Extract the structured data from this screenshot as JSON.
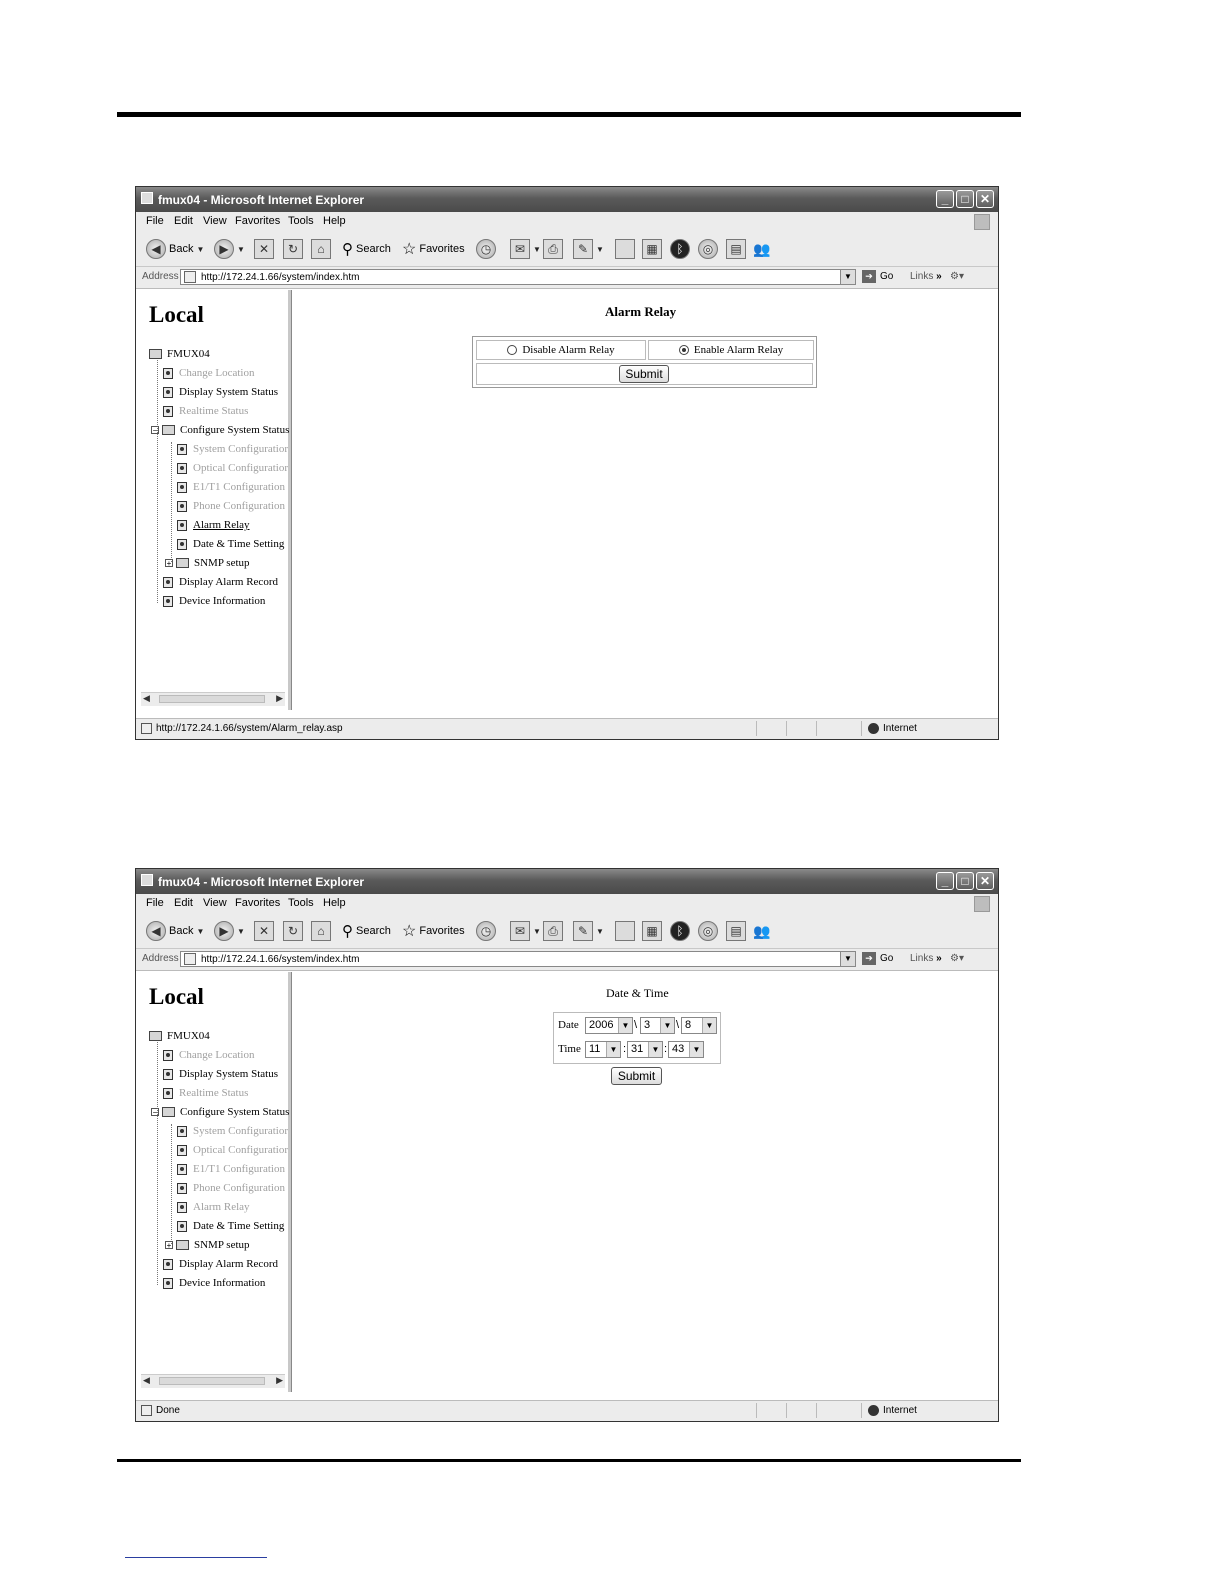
{
  "browser": {
    "window_title": "fmux04 - Microsoft Internet Explorer",
    "menu": [
      "File",
      "Edit",
      "View",
      "Favorites",
      "Tools",
      "Help"
    ],
    "toolbar": {
      "back": "Back",
      "search": "Search",
      "favorites": "Favorites"
    },
    "address_label": "Address",
    "address_url": "http://172.24.1.66/system/index.htm",
    "go_label": "Go",
    "links_label": "Links",
    "zone": "Internet"
  },
  "sidebar": {
    "heading": "Local",
    "root": "FMUX04",
    "items": [
      "Change Location",
      "Display System Status",
      "Realtime Status",
      "Configure System Status",
      "System Configuratior",
      "Optical Configuratior",
      "E1/T1 Configuration",
      "Phone Configuration",
      "Alarm Relay",
      "Date & Time Setting",
      "SNMP setup",
      "Display Alarm Record",
      "Device Information"
    ]
  },
  "screen1": {
    "status_text": "http://172.24.1.66/system/Alarm_relay.asp",
    "title": "Alarm Relay",
    "option_disable": "Disable Alarm Relay",
    "option_enable": "Enable Alarm Relay",
    "selected": "Enable Alarm Relay",
    "submit": "Submit"
  },
  "screen2": {
    "status_text": "Done",
    "title": "Date & Time",
    "date_label": "Date",
    "time_label": "Time",
    "year": "2006",
    "month": "3",
    "day": "8",
    "hour": "11",
    "minute": "31",
    "second": "43",
    "date_sep": "\\",
    "time_sep": ":",
    "submit": "Submit"
  }
}
